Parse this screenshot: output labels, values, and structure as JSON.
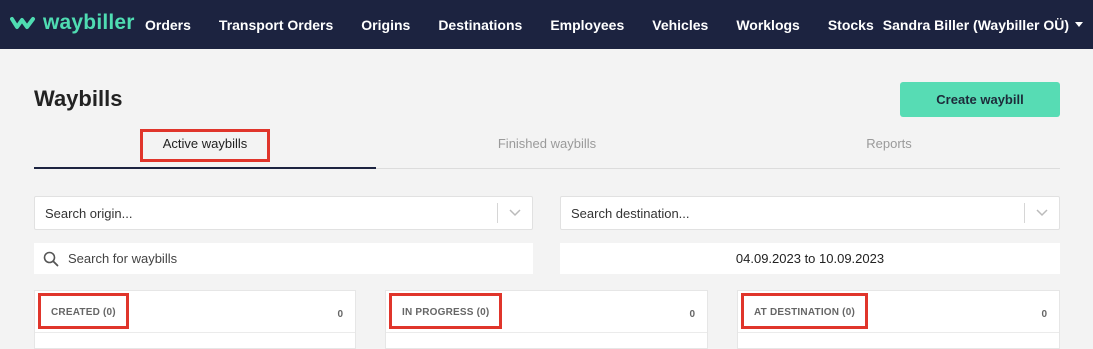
{
  "nav": {
    "logo_text": "waybiller",
    "links": [
      "Orders",
      "Transport Orders",
      "Origins",
      "Destinations",
      "Employees",
      "Vehicles",
      "Worklogs",
      "Stocks"
    ],
    "user": "Sandra Biller (Waybiller OÜ)"
  },
  "page": {
    "title": "Waybills",
    "create_button": "Create waybill"
  },
  "tabs": [
    {
      "label": "Active waybills",
      "active": true
    },
    {
      "label": "Finished waybills",
      "active": false
    },
    {
      "label": "Reports",
      "active": false
    }
  ],
  "filters": {
    "origin_placeholder": "Search origin...",
    "destination_placeholder": "Search destination...",
    "search_placeholder": "Search for waybills",
    "date_range": "04.09.2023 to 10.09.2023"
  },
  "columns": [
    {
      "title": "CREATED (0)",
      "count": "0"
    },
    {
      "title": "IN PROGRESS (0)",
      "count": "0"
    },
    {
      "title": "AT DESTINATION (0)",
      "count": "0"
    }
  ],
  "colors": {
    "nav_bg": "#1c2340",
    "brand_accent": "#4fdcb2",
    "create_button": "#57dcb4",
    "highlight_box": "#e0352b"
  }
}
